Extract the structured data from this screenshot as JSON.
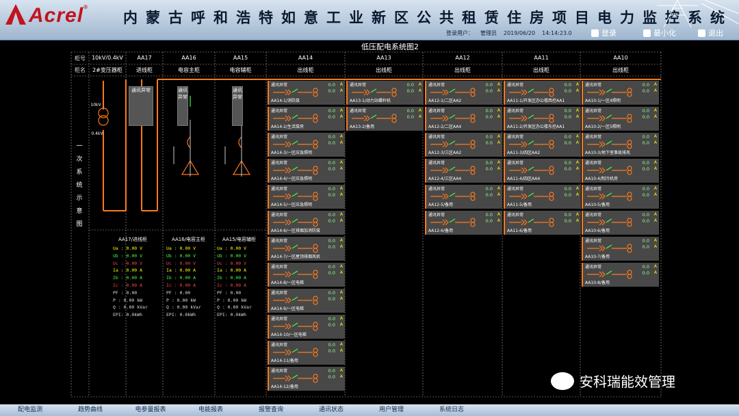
{
  "header": {
    "brand": "Acrel",
    "title": "内蒙古呼和浩特如意工业新区公共租赁住房项目电力监控系统",
    "user_label": "登录用户：",
    "user": "管理员",
    "date": "2019/06/20",
    "time": "14:14:23.0",
    "login": "登录",
    "minimize": "最小化",
    "exit": "退出"
  },
  "diagram_title": "低压配电系统图2",
  "cabinet_no_label": "柜号",
  "cabinet_name_label": "柜名",
  "voltage": "10kV/0.4kV",
  "transformer": "2#变压器柜",
  "primary_label": "一次系统示意图",
  "cabinets": [
    {
      "no": "AA17",
      "name": "进线柜"
    },
    {
      "no": "AA16",
      "name": "电容主柜"
    },
    {
      "no": "AA15",
      "name": "电容辅柜"
    },
    {
      "no": "AA14",
      "name": "出线柜"
    },
    {
      "no": "AA13",
      "name": "出线柜"
    },
    {
      "no": "AA12",
      "name": "出线柜"
    },
    {
      "no": "AA11",
      "name": "出线柜"
    },
    {
      "no": "AA10",
      "name": "出线柜"
    }
  ],
  "comm_box": "通讯异常",
  "labels": {
    "tv1": "10kV",
    "tv2": "0.4kV"
  },
  "meters": [
    {
      "title": "AA17/进线柜",
      "rows": [
        "Ua :    0.00 V",
        "Ub :    0.00 V",
        "Uc :    0.00 V",
        "Ia :    0.00 A",
        "Ib :    0.00 A",
        "Ic :    0.00 A",
        "PF :    0.00",
        "P  :    0.00 kW",
        "Q  :    0.00 kVar",
        "EPI:       0.0kWh"
      ]
    },
    {
      "title": "AA16/电容主柜",
      "rows": [
        "Ua :    0.00 V",
        "Ub :    0.00 V",
        "Uc :    0.00 V",
        "Ia :    0.00 A",
        "Ib :    0.00 A",
        "Ic :    0.00 A",
        "PF :    0.00",
        "P  :    0.00 kW",
        "Q  :    0.00 kVar",
        "EPI:       0.0kWh"
      ]
    },
    {
      "title": "AA15/电容辅柜",
      "rows": [
        "Ua :    0.00 V",
        "Ub :    0.00 V",
        "Uc :    0.00 V",
        "Ia :    0.00 A",
        "Ib :    0.00 A",
        "Ic :    0.00 A",
        "PF :    0.00",
        "P  :    0.00 kW",
        "Q  :    0.00 kVar",
        "EPI:       0.0kWh"
      ]
    }
  ],
  "feeders": {
    "status": "通讯异常",
    "value": "0.0",
    "unit": "A",
    "AA14": [
      "AA14-1/消防泵",
      "AA14-2/生活泵房",
      "AA14-3/一区应急照明",
      "AA14-4/一区应急照明",
      "AA14-5/一区应急照明",
      "AA14-6/一区排烟加消防泵",
      "AA14-7/一区屋顶排烟风机",
      "AA14-8/一区电梯",
      "AA14-9/一区电梯",
      "AA14-10/一区电梯",
      "AA14-11/备用",
      "AA14-12/备用"
    ],
    "AA13": [
      "AA13-1/动力站螺杆机",
      "AA13-2/备用"
    ],
    "AA12": [
      "AA12-1/二区AA2",
      "AA12-2/二区AA4",
      "AA12-3/三区AA2",
      "AA12-4/三区AA4",
      "AA12-5/备用",
      "AA12-6/备用"
    ],
    "AA11": [
      "AA11-1/开发区办公楼西控AA1",
      "AA11-2/开发区办公楼东控AA1",
      "AA11-3/四区AA2",
      "AA11-4/四区AA4",
      "AA11-5/备用",
      "AA11-6/备用"
    ],
    "AA10": [
      "AA10-1/一区4照明",
      "AA10-2/一区5照明",
      "AA10-3/地下室事故排风",
      "AA10-4/制冷机房",
      "AA10-5/备用",
      "AA10-6/备用",
      "AA10-7/备用",
      "AA10-8/备用"
    ]
  },
  "watermark": "安科瑞能效管理",
  "nav": [
    "配电监测",
    "趋势曲线",
    "电参量报表",
    "电能报表",
    "报警查询",
    "通讯状态",
    "用户管理",
    "系统日志"
  ]
}
